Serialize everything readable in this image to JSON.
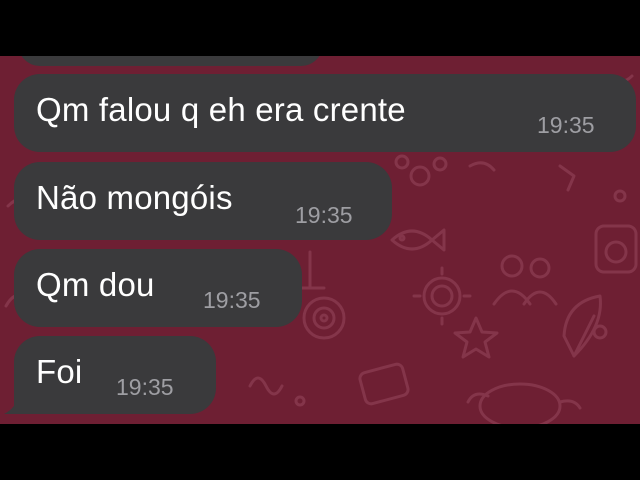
{
  "colors": {
    "wallpaper": "#6e1f33",
    "bubble": "#3a3a3c",
    "text": "#ffffff",
    "timestamp": "#9e9ea3",
    "letterbox": "#000000"
  },
  "wallpaper_icons": [
    "fish-icon",
    "gear-icon",
    "users-icon",
    "star-icon",
    "camera-icon",
    "turtle-icon",
    "leaf-icon",
    "paw-icon"
  ],
  "messages": [
    {
      "text": "Qm falou q eh era crente",
      "time": "19:35"
    },
    {
      "text": "Não mongóis",
      "time": "19:35"
    },
    {
      "text": "Qm dou",
      "time": "19:35"
    },
    {
      "text": "Foi",
      "time": "19:35"
    }
  ]
}
